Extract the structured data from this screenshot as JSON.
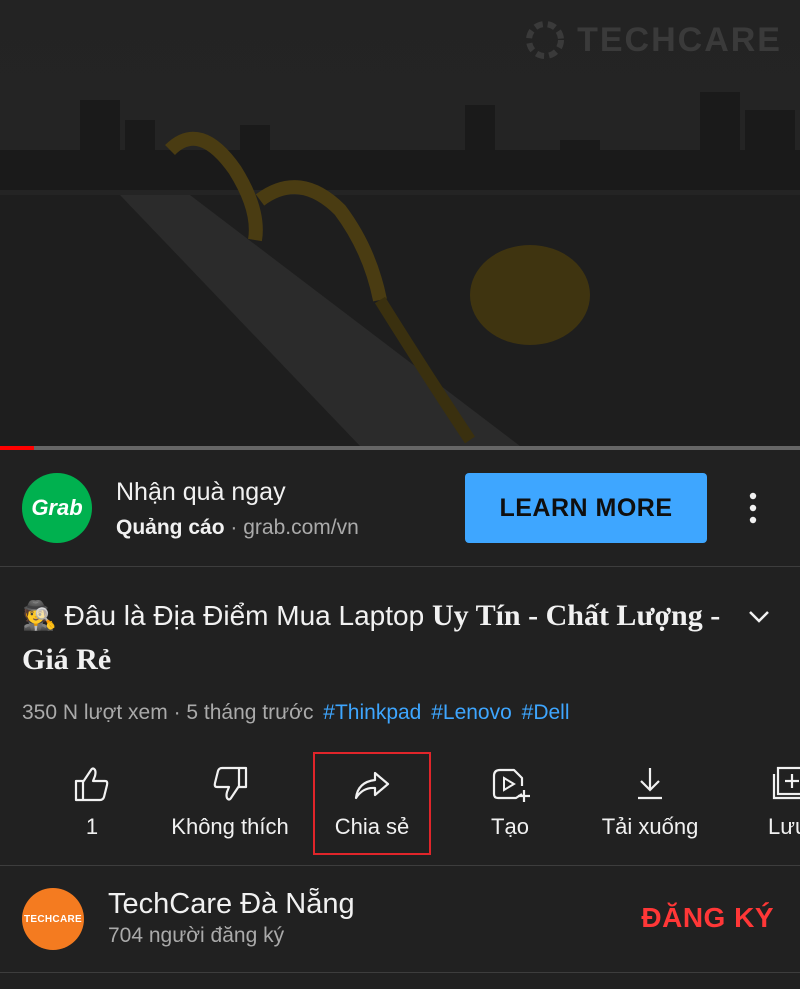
{
  "video": {
    "watermark": "TECHCARE",
    "progress": 0.042
  },
  "ad": {
    "logo_text": "Grab",
    "title": "Nhận quà ngay",
    "sponsored": "Quảng cáo",
    "separator": "·",
    "domain": "grab.com/vn",
    "cta_label": "LEARN MORE",
    "menu_icon": "more-vert-icon"
  },
  "video_info": {
    "title_emoji": "🕵️",
    "title_part1": "Đâu là Địa Điểm Mua Laptop ",
    "title_part2": "Uy Tín - Chất Lượng - Giá Rẻ",
    "views": "350 N lượt xem",
    "time": "· 5 tháng trước",
    "tags": [
      "#Thinkpad",
      "#Lenovo",
      "#Dell"
    ]
  },
  "actions": [
    {
      "icon": "thumbs-up-icon",
      "label": "1"
    },
    {
      "icon": "thumbs-down-icon",
      "label": "Không thích"
    },
    {
      "icon": "share-icon",
      "label": "Chia sẻ"
    },
    {
      "icon": "create-icon",
      "label": "Tạo"
    },
    {
      "icon": "download-icon",
      "label": "Tải xuống"
    },
    {
      "icon": "save-icon",
      "label": "Lưu"
    }
  ],
  "channel": {
    "avatar_text": "TECHCARE",
    "name": "TechCare Đà Nẵng",
    "subscribers": "704 người đăng ký",
    "subscribe_label": "ĐĂNG KÝ"
  },
  "colors": {
    "background": "#212121",
    "accent_blue": "#3ea6ff",
    "subscribe_red": "#ff3737",
    "progress_red": "#ff0000",
    "grab_green": "#00b14f",
    "highlight_box": "#e0252a"
  }
}
